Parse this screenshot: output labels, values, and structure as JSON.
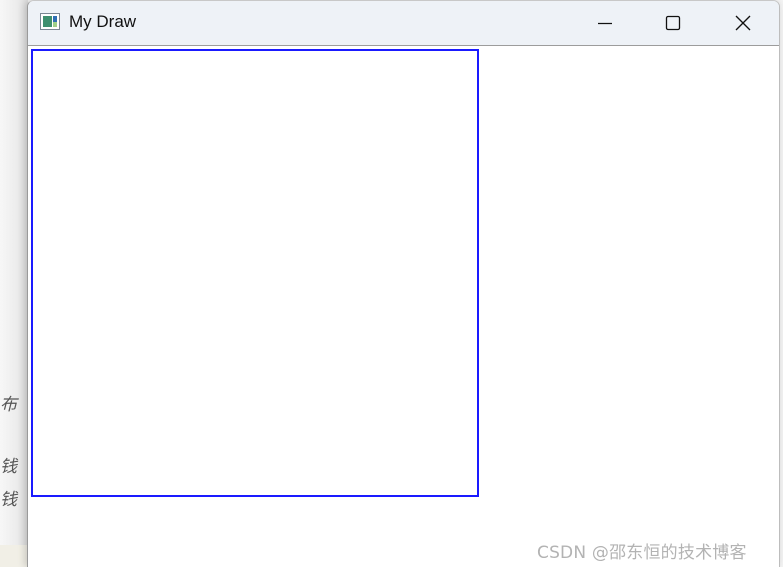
{
  "background": {
    "fragments": [
      "布",
      "钱",
      "钱"
    ]
  },
  "window": {
    "title": "My Draw",
    "app_icon": "app-window-icon",
    "controls": {
      "minimize_icon": "minimize-icon",
      "maximize_icon": "maximize-icon",
      "close_icon": "close-icon"
    }
  },
  "canvas": {
    "rectangle_color": "#1a1aff"
  },
  "watermark": {
    "text": "CSDN @邵东恒的技术博客"
  }
}
